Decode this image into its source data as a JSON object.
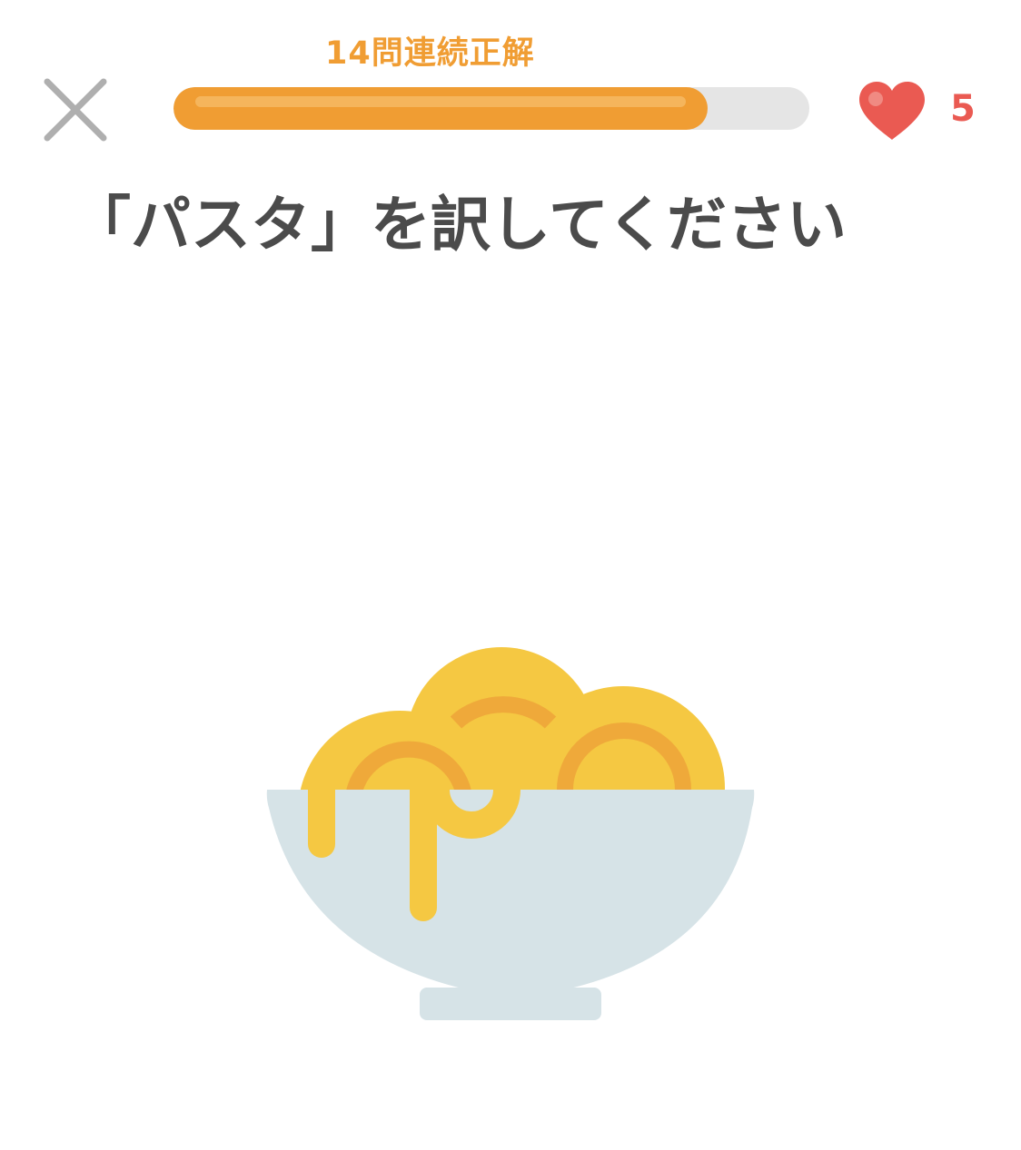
{
  "header": {
    "streak_text": "14問連続正解",
    "progress": 0.84,
    "hearts": "5",
    "colors": {
      "accent": "#f09d33",
      "heart": "#ea5a52",
      "track": "#e5e5e5",
      "close": "#afafaf"
    },
    "icons": {
      "close": "close-icon",
      "heart": "heart-icon"
    }
  },
  "challenge": {
    "prompt": "「パスタ」を訳してください",
    "image": "pasta-bowl-illustration"
  }
}
